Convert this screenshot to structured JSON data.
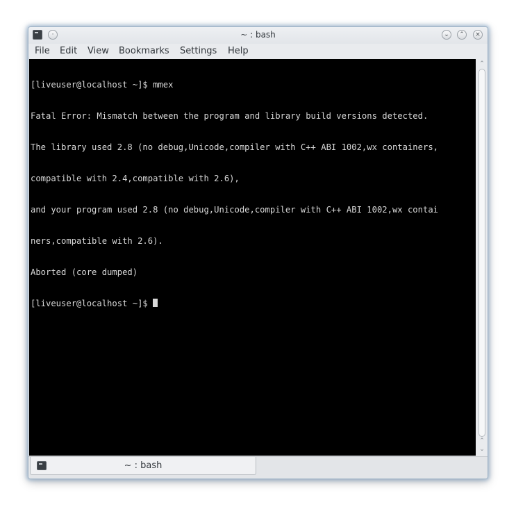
{
  "window": {
    "title": "~ : bash"
  },
  "menu": {
    "items": [
      "File",
      "Edit",
      "View",
      "Bookmarks",
      "Settings",
      "Help"
    ]
  },
  "terminal": {
    "lines": [
      "[liveuser@localhost ~]$ mmex",
      "Fatal Error: Mismatch between the program and library build versions detected.",
      "The library used 2.8 (no debug,Unicode,compiler with C++ ABI 1002,wx containers,",
      "compatible with 2.4,compatible with 2.6),",
      "and your program used 2.8 (no debug,Unicode,compiler with C++ ABI 1002,wx contai",
      "ners,compatible with 2.6).",
      "Aborted (core dumped)"
    ],
    "prompt": "[liveuser@localhost ~]$ "
  },
  "tabs": [
    {
      "label": "~ : bash",
      "icon": "terminal-icon"
    }
  ],
  "icons": {
    "window": "terminal-icon",
    "keep_above": "pin-icon",
    "minimize": "chevron-down-icon",
    "maximize": "chevron-up-icon",
    "close": "close-icon"
  }
}
